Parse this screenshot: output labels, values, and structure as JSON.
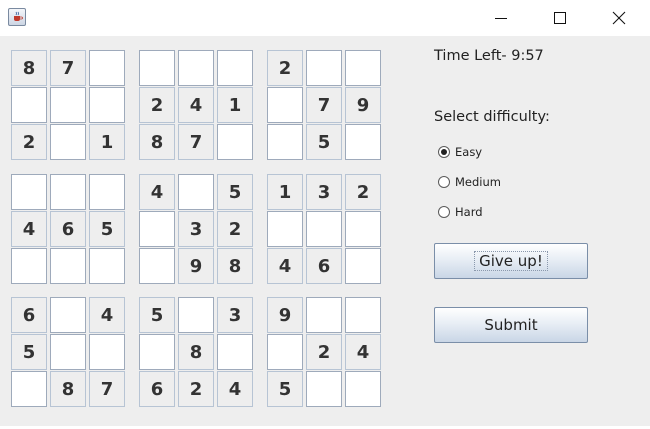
{
  "window": {
    "icon": "java-cup-icon",
    "controls": [
      "minimize-icon",
      "maximize-icon",
      "close-icon"
    ]
  },
  "timer": {
    "label": "Time Left- 9:57"
  },
  "difficulty": {
    "heading": "Select difficulty:",
    "options": [
      {
        "label": "Easy",
        "checked": true
      },
      {
        "label": "Medium",
        "checked": false
      },
      {
        "label": "Hard",
        "checked": false
      }
    ]
  },
  "buttons": {
    "give_up": "Give up!",
    "submit": "Submit"
  },
  "board": [
    [
      "8",
      "7",
      "",
      "",
      "",
      "",
      "2",
      "",
      ""
    ],
    [
      "",
      "",
      "",
      "2",
      "4",
      "1",
      "",
      "7",
      "9"
    ],
    [
      "2",
      "",
      "1",
      "8",
      "7",
      "",
      "",
      "5",
      ""
    ],
    [
      "",
      "",
      "",
      "4",
      "",
      "5",
      "1",
      "3",
      "2"
    ],
    [
      "4",
      "6",
      "5",
      "",
      "3",
      "2",
      "",
      "",
      ""
    ],
    [
      "",
      "",
      "",
      "",
      "9",
      "8",
      "4",
      "6",
      ""
    ],
    [
      "6",
      "",
      "4",
      "5",
      "",
      "3",
      "9",
      "",
      ""
    ],
    [
      "5",
      "",
      "",
      "",
      "8",
      "",
      "",
      "2",
      "4"
    ],
    [
      "",
      "8",
      "7",
      "6",
      "2",
      "4",
      "5",
      "",
      ""
    ]
  ],
  "colors": {
    "window_bg": "#eeeeee",
    "cell_border": "#b7c4d4",
    "digit": "#333333"
  }
}
